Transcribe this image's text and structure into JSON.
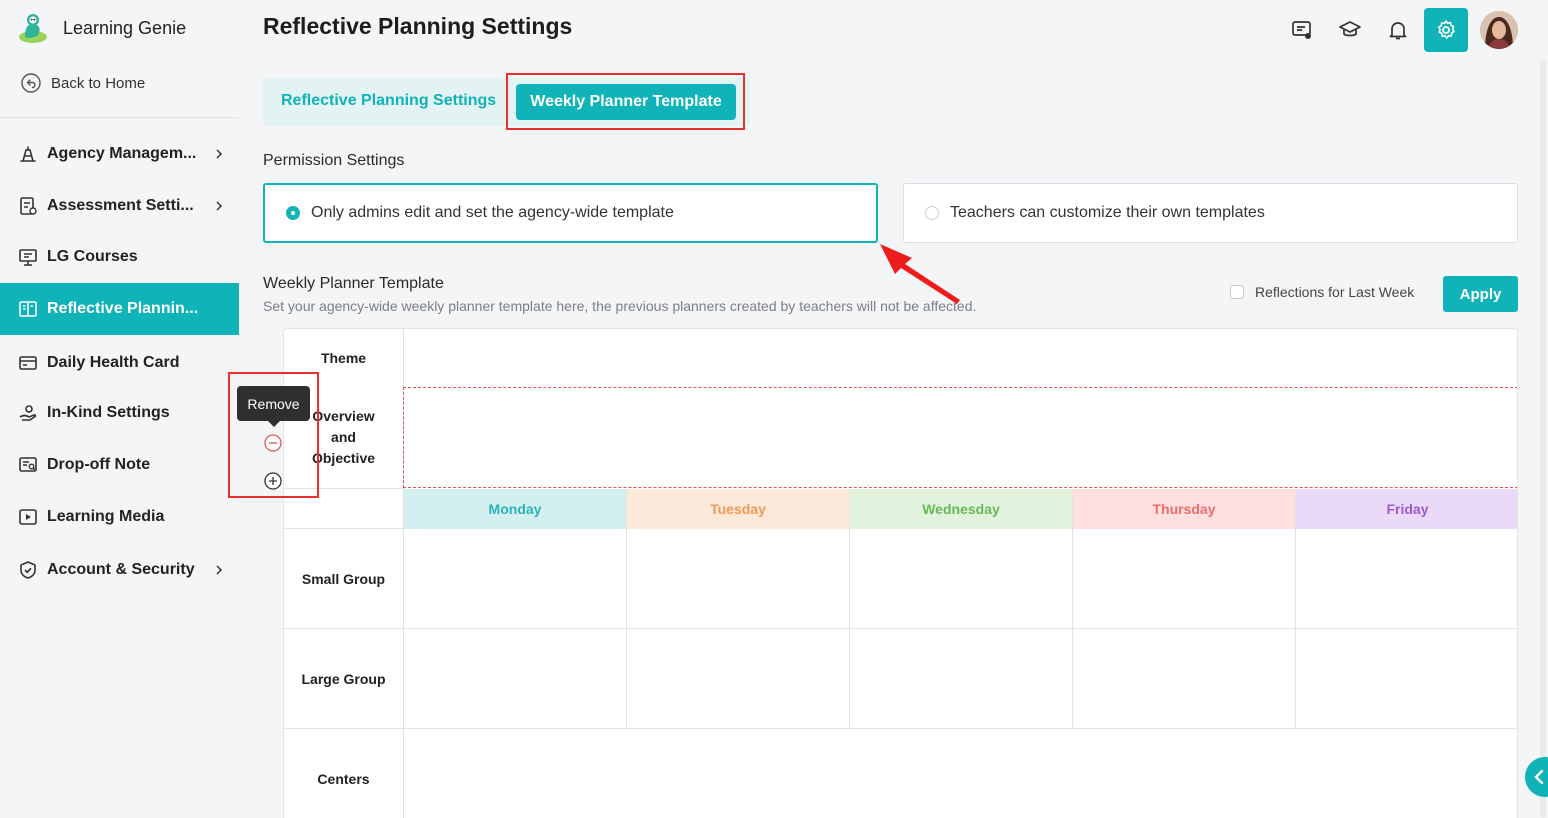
{
  "app": {
    "name": "Learning Genie"
  },
  "sidebar": {
    "back_home": "Back to Home",
    "items": [
      {
        "label": "Agency Managem...",
        "icon": "agency-icon",
        "has_chevron": true,
        "active": false
      },
      {
        "label": "Assessment Setti...",
        "icon": "assessment-icon",
        "has_chevron": true,
        "active": false
      },
      {
        "label": "LG Courses",
        "icon": "courses-icon",
        "has_chevron": false,
        "active": false
      },
      {
        "label": "Reflective Plannin...",
        "icon": "book-icon",
        "has_chevron": false,
        "active": true
      },
      {
        "label": "Daily Health Card",
        "icon": "health-card-icon",
        "has_chevron": false,
        "active": false
      },
      {
        "label": "In-Kind Settings",
        "icon": "in-kind-icon",
        "has_chevron": false,
        "active": false
      },
      {
        "label": "Drop-off Note",
        "icon": "note-icon",
        "has_chevron": false,
        "active": false
      },
      {
        "label": "Learning Media",
        "icon": "media-icon",
        "has_chevron": false,
        "active": false
      },
      {
        "label": "Account & Security",
        "icon": "shield-icon",
        "has_chevron": true,
        "active": false
      }
    ]
  },
  "header": {
    "title": "Reflective Planning Settings",
    "icons": [
      "chat-icon",
      "graduation-cap-icon",
      "bell-icon",
      "gear-icon"
    ]
  },
  "tabs": [
    {
      "label": "Reflective Planning Settings",
      "active": false
    },
    {
      "label": "Weekly Planner Template",
      "active": true
    }
  ],
  "permission": {
    "title": "Permission Settings",
    "options": [
      {
        "label": "Only admins edit and set the agency-wide template",
        "selected": true
      },
      {
        "label": "Teachers can customize their own templates",
        "selected": false
      }
    ]
  },
  "template": {
    "title": "Weekly Planner Template",
    "description": "Set your agency-wide weekly planner template here, the previous planners created by teachers will not be affected.",
    "reflections_label": "Reflections for Last Week",
    "reflections_checked": false,
    "apply_label": "Apply",
    "rows": {
      "theme": "Theme",
      "overview": [
        "Overview",
        "and",
        "Objective"
      ],
      "small_group": "Small Group",
      "large_group": "Large Group",
      "centers": "Centers"
    },
    "days": [
      {
        "label": "Monday",
        "bg": "#d3eff0",
        "color": "#2ab3b8"
      },
      {
        "label": "Tuesday",
        "bg": "#fce9da",
        "color": "#ef9a52"
      },
      {
        "label": "Wednesday",
        "bg": "#e1f3dc",
        "color": "#6ab759"
      },
      {
        "label": "Thursday",
        "bg": "#fde0df",
        "color": "#ee6c6b"
      },
      {
        "label": "Friday",
        "bg": "#ead9f7",
        "color": "#9b5bd0"
      }
    ]
  },
  "tooltip": {
    "remove": "Remove"
  },
  "colors": {
    "accent": "#10b3b7",
    "highlight": "#e8302c"
  }
}
